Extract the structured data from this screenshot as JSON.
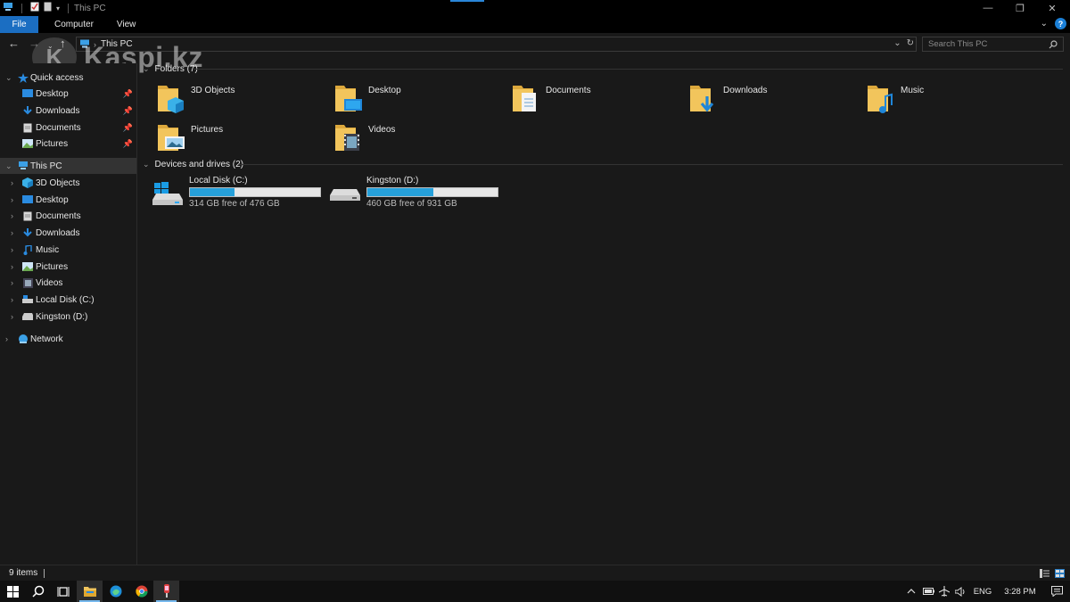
{
  "window": {
    "title": "This PC",
    "controls": {
      "minimize": "—",
      "maximize": "❐",
      "close": "✕"
    }
  },
  "ribbon": {
    "tabs": [
      {
        "label": "File"
      },
      {
        "label": "Computer"
      },
      {
        "label": "View"
      }
    ],
    "help": "?"
  },
  "address": {
    "path": "This PC",
    "search_placeholder": "Search This PC"
  },
  "watermark": {
    "text": "Kaspi.kz"
  },
  "nav": {
    "quick_access": {
      "label": "Quick access",
      "items": [
        {
          "label": "Desktop",
          "icon": "desktop-icon"
        },
        {
          "label": "Downloads",
          "icon": "download-icon"
        },
        {
          "label": "Documents",
          "icon": "documents-icon"
        },
        {
          "label": "Pictures",
          "icon": "pictures-icon"
        }
      ]
    },
    "this_pc": {
      "label": "This PC",
      "items": [
        {
          "label": "3D Objects"
        },
        {
          "label": "Desktop"
        },
        {
          "label": "Documents"
        },
        {
          "label": "Downloads"
        },
        {
          "label": "Music"
        },
        {
          "label": "Pictures"
        },
        {
          "label": "Videos"
        },
        {
          "label": "Local Disk (C:)"
        },
        {
          "label": "Kingston (D:)"
        }
      ]
    },
    "network": {
      "label": "Network"
    }
  },
  "content": {
    "folders_header": "Folders (7)",
    "folders": [
      {
        "label": "3D Objects",
        "icon": "3d-objects-folder-icon"
      },
      {
        "label": "Desktop",
        "icon": "desktop-folder-icon"
      },
      {
        "label": "Documents",
        "icon": "documents-folder-icon"
      },
      {
        "label": "Downloads",
        "icon": "downloads-folder-icon"
      },
      {
        "label": "Music",
        "icon": "music-folder-icon"
      },
      {
        "label": "Pictures",
        "icon": "pictures-folder-icon"
      },
      {
        "label": "Videos",
        "icon": "videos-folder-icon"
      }
    ],
    "drives_header": "Devices and drives (2)",
    "drives": [
      {
        "name": "Local Disk (C:)",
        "free": "314 GB free of 476 GB",
        "used_fraction": 0.34
      },
      {
        "name": "Kingston (D:)",
        "free": "460 GB free of 931 GB",
        "used_fraction": 0.51
      }
    ]
  },
  "status": {
    "items": "9 items"
  },
  "taskbar": {
    "language": "ENG",
    "time": "3:28 PM"
  },
  "colors": {
    "accent": "#1b6ec2",
    "drive_bar": "#26a0da",
    "folder_yellow": "#f2c55c"
  }
}
